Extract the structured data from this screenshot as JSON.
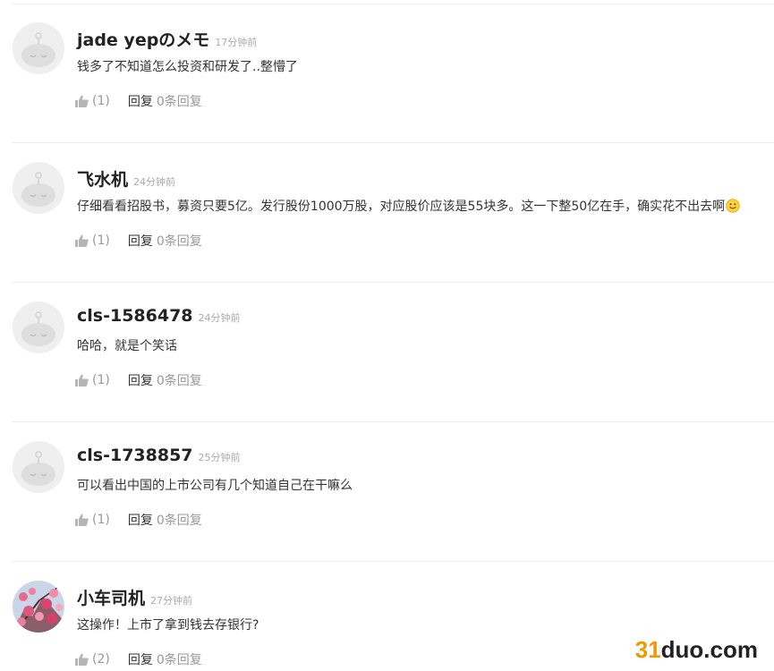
{
  "comments": [
    {
      "name": "jade yepのメモ",
      "time": "17分钟前",
      "text": "钱多了不知道怎么投资和研发了..整懵了",
      "likes": "(1)",
      "reply_label": "回复",
      "reply_count": "0条回复",
      "avatar": "default-avatar"
    },
    {
      "name": "飞水机",
      "time": "24分钟前",
      "text": "仔细看看招股书，募资只要5亿。发行股份1000万股，对应股价应该是55块多。这一下整50亿在手，确实花不出去啊",
      "likes": "(1)",
      "reply_label": "回复",
      "reply_count": "0条回复",
      "avatar": "default-avatar",
      "emoji": "smile-emoji"
    },
    {
      "name": "cls-1586478",
      "time": "24分钟前",
      "text": "哈哈，就是个笑话",
      "likes": "(1)",
      "reply_label": "回复",
      "reply_count": "0条回复",
      "avatar": "default-avatar"
    },
    {
      "name": "cls-1738857",
      "time": "25分钟前",
      "text": "可以看出中国的上市公司有几个知道自己在干嘛么",
      "likes": "(1)",
      "reply_label": "回复",
      "reply_count": "0条回复",
      "avatar": "default-avatar"
    },
    {
      "name": "小车司机",
      "time": "27分钟前",
      "text": "这操作！上市了拿到钱去存银行?",
      "likes": "(2)",
      "reply_label": "回复",
      "reply_count": "0条回复",
      "avatar": "plum-blossom-photo"
    }
  ],
  "watermark": {
    "number": "31",
    "word": "duo.com"
  },
  "colors": {
    "divider": "#ececec",
    "name": "#222222",
    "time": "#aaaaaa",
    "watermark_accent": "#f39800"
  }
}
